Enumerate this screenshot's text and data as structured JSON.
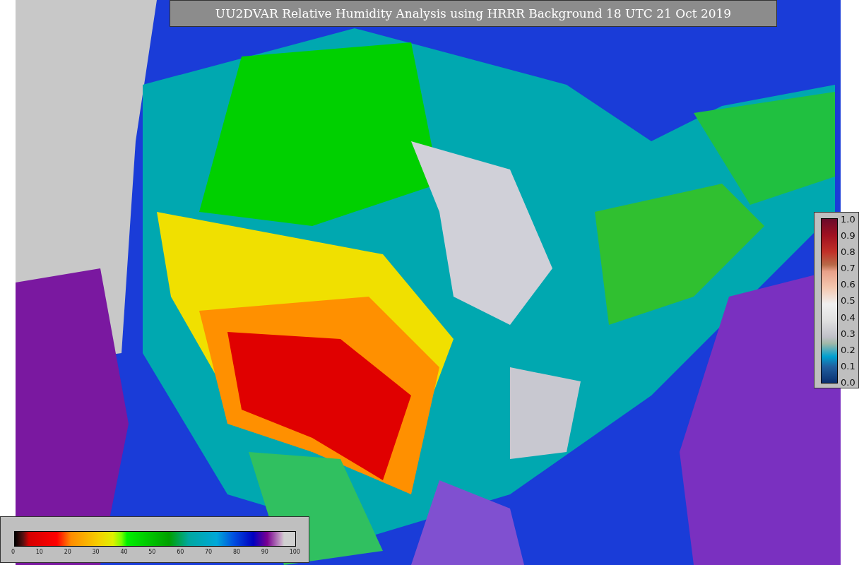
{
  "title": "UU2DVAR Relative Humidity Analysis using HRRR Background 18 UTC 21 Oct 2019",
  "humidity_colorbar": {
    "ticks": [
      "0",
      "10",
      "20",
      "30",
      "40",
      "50",
      "60",
      "70",
      "80",
      "90",
      "100"
    ]
  },
  "ratio_colorbar": {
    "ticks": [
      "1.0",
      "0.9",
      "0.8",
      "0.7",
      "0.6",
      "0.5",
      "0.4",
      "0.3",
      "0.2",
      "0.1",
      "0.0"
    ]
  }
}
